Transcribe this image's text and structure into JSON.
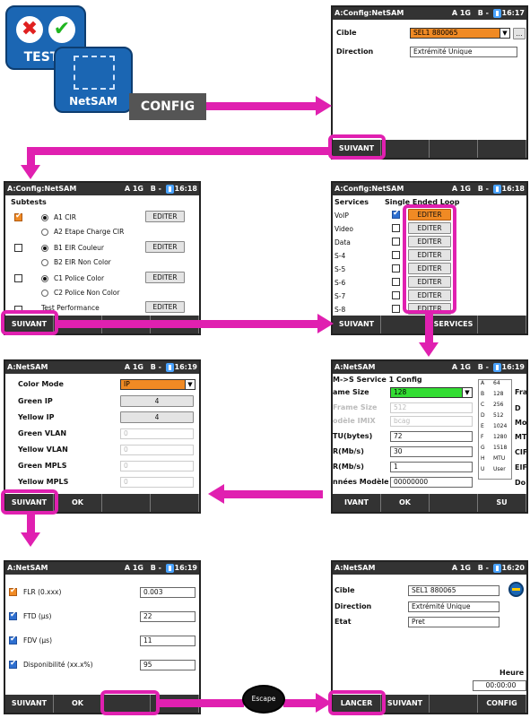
{
  "top": {
    "tests_label": "TESTS",
    "netsam_label": "NetSAM",
    "config_label": "CONFIG"
  },
  "p1": {
    "title": "A:Config:NetSAM",
    "port_a": "A 1G",
    "port_b": "B -",
    "time": "16:17",
    "cible_label": "Cible",
    "cible_value": "SEL1 880065",
    "browse": "...",
    "direction_label": "Direction",
    "direction_value": "Extrémité Unique",
    "next": "SUIVANT"
  },
  "p2": {
    "title": "A:Config:NetSAM",
    "port_a": "A 1G",
    "port_b": "B -",
    "time": "16:18",
    "header": "Subtests",
    "rows": [
      {
        "label": "A1 CIR",
        "sub": "A2 Etape Charge CIR",
        "button": "EDITER"
      },
      {
        "label": "B1 EIR Couleur",
        "sub": "B2 EIR Non Color",
        "button": "EDITER"
      },
      {
        "label": "C1 Police Color",
        "sub": "C2 Police Non Color",
        "button": "EDITER"
      }
    ],
    "perf_label": "Test Performance",
    "perf_button": "EDITER",
    "next": "SUIVANT"
  },
  "p3": {
    "title": "A:Config:NetSAM",
    "port_a": "A 1G",
    "port_b": "B -",
    "time": "16:18",
    "col1": "Services",
    "col2": "Single Ended Loop",
    "services": [
      "VoIP",
      "Video",
      "Data",
      "S-4",
      "S-5",
      "S-6",
      "S-7",
      "S-8"
    ],
    "button": "EDITER",
    "next": "SUIVANT",
    "services_btn": "SERVICES"
  },
  "p4": {
    "title": "A:NetSAM",
    "port_a": "A 1G",
    "port_b": "B -",
    "time": "16:19",
    "color_mode_label": "Color Mode",
    "color_mode_value": "IP",
    "rows": [
      {
        "label": "Green IP",
        "value": "4"
      },
      {
        "label": "Yellow IP",
        "value": "4"
      },
      {
        "label": "Green VLAN",
        "value": "0"
      },
      {
        "label": "Yellow VLAN",
        "value": "0"
      },
      {
        "label": "Green MPLS",
        "value": "0"
      },
      {
        "label": "Yellow MPLS",
        "value": "0"
      }
    ],
    "next": "SUIVANT",
    "ok": "OK"
  },
  "p5": {
    "title": "A:NetSAM",
    "port_a": "A 1G",
    "port_b": "B -",
    "time": "16:19",
    "subtitle": "M->S Service 1 Config",
    "frame_label": "ame Size",
    "frame_value": "128",
    "frame_size_label": "Frame Size",
    "frame_size_value": "512",
    "model_label": "odèle IMIX",
    "model_value": "bcag",
    "mtu_label": "TU(bytes)",
    "mtu_value": "72",
    "cir_label": "R(Mb/s)",
    "cir_value": "30",
    "eir_label": "R(Mb/s)",
    "eir_value": "1",
    "data_label": "nnées Modèle",
    "data_value": "00000000",
    "table": [
      [
        "A",
        "64"
      ],
      [
        "B",
        "128"
      ],
      [
        "C",
        "256"
      ],
      [
        "D",
        "512"
      ],
      [
        "E",
        "1024"
      ],
      [
        "F",
        "1280"
      ],
      [
        "G",
        "1518"
      ],
      [
        "H",
        "MTU"
      ],
      [
        "U",
        "User"
      ]
    ],
    "right_labels": [
      "Fra",
      "D",
      "Mo",
      "MT",
      "CIF",
      "EIF",
      "Do"
    ],
    "next": "IVANT",
    "ok": "OK",
    "su": "SU"
  },
  "p6": {
    "title": "A:NetSAM",
    "port_a": "A 1G",
    "port_b": "B -",
    "time": "16:19",
    "rows": [
      {
        "label": "FLR (0.xxx)",
        "value": "0.003"
      },
      {
        "label": "FTD (µs)",
        "value": "22"
      },
      {
        "label": "FDV (µs)",
        "value": "11"
      },
      {
        "label": "Disponibilité (xx.x%)",
        "value": "95"
      }
    ],
    "next": "SUIVANT",
    "ok": "OK"
  },
  "p7": {
    "title": "A:NetSAM",
    "port_a": "A 1G",
    "port_b": "B -",
    "time": "16:20",
    "cible_label": "Cible",
    "cible_value": "SEL1 880065",
    "direction_label": "Direction",
    "direction_value": "Extrémité Unique",
    "etat_label": "Etat",
    "etat_value": "Pret",
    "heure_label": "Heure",
    "heure_value": "00:00:00",
    "launch": "LANCER",
    "next": "SUIVANT",
    "config": "CONFIG"
  },
  "escape_label": "Escape",
  "colors": {
    "highlight": "#e020b0",
    "title_bar": "#333333",
    "orange": "#f08a24",
    "green": "#33dd33",
    "checkbox": "#2e6fd0"
  }
}
